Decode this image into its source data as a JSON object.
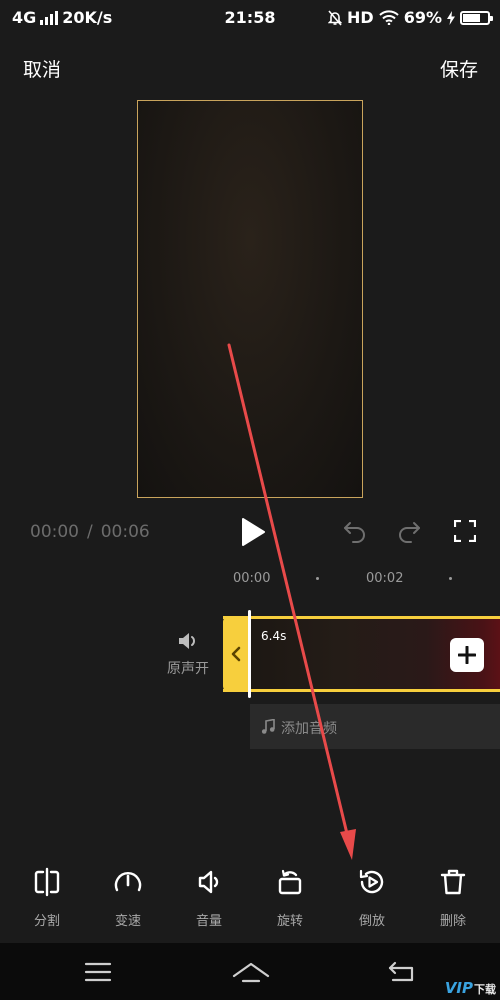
{
  "status_bar": {
    "network": "4G",
    "speed": "20K/s",
    "time": "21:58",
    "hd": "HD",
    "battery": "69%",
    "battery_level": 0.69
  },
  "top_bar": {
    "cancel_label": "取消",
    "save_label": "保存"
  },
  "playback": {
    "current_time": "00:00",
    "separator": "/",
    "total_time": "00:06"
  },
  "ruler": {
    "ticks": [
      "00:00",
      "00:02"
    ]
  },
  "track": {
    "original_audio_label": "原声开",
    "clip_duration": "6.4s",
    "add_music_label": "添加音频"
  },
  "toolbar": {
    "items": [
      {
        "label": "分割",
        "icon": "split-icon"
      },
      {
        "label": "变速",
        "icon": "speedometer-icon"
      },
      {
        "label": "音量",
        "icon": "volume-icon"
      },
      {
        "label": "旋转",
        "icon": "rotate-icon"
      },
      {
        "label": "倒放",
        "icon": "reverse-play-icon"
      },
      {
        "label": "删除",
        "icon": "trash-icon"
      }
    ]
  },
  "watermark": {
    "brand": "VIP",
    "suffix": "下载"
  },
  "colors": {
    "accent": "#f7cf3d",
    "annotation_arrow": "#e84a4a",
    "background": "#1b1b1b"
  }
}
